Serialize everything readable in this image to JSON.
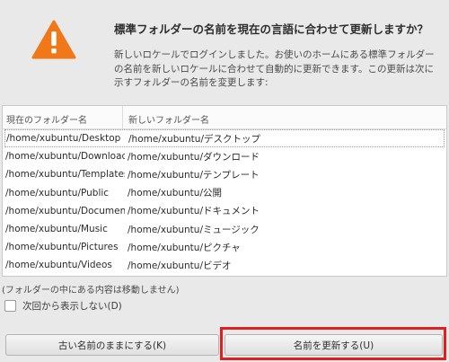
{
  "dialog": {
    "title": "標準フォルダーの名前を現在の言語に合わせて更新しますか？",
    "description": "新しいロケールでログインしました。お使いのホームにある標準フォルダーの名前を新しいロケールに合わせて自動的に更新できます。この更新は次に示すフォルダーの名前を変更します:",
    "icon": "warning-icon",
    "accent_color": "#f07818"
  },
  "table": {
    "headers": [
      "現在のフォルダー名",
      "新しいフォルダー名"
    ],
    "rows": [
      [
        "/home/xubuntu/Desktop",
        "/home/xubuntu/デスクトップ"
      ],
      [
        "/home/xubuntu/Downloads",
        "/home/xubuntu/ダウンロード"
      ],
      [
        "/home/xubuntu/Templates",
        "/home/xubuntu/テンプレート"
      ],
      [
        "/home/xubuntu/Public",
        "/home/xubuntu/公開"
      ],
      [
        "/home/xubuntu/Documents",
        "/home/xubuntu/ドキュメント"
      ],
      [
        "/home/xubuntu/Music",
        "/home/xubuntu/ミュージック"
      ],
      [
        "/home/xubuntu/Pictures",
        "/home/xubuntu/ピクチャ"
      ],
      [
        "/home/xubuntu/Videos",
        "/home/xubuntu/ビデオ"
      ]
    ]
  },
  "note": "(フォルダーの中にある内容は移動しません)",
  "checkbox": {
    "label": "次回から表示しない(D)",
    "checked": false
  },
  "buttons": {
    "keep_old": "古い名前のままにする(K)",
    "update": "名前を更新する(U)"
  },
  "highlight_color": "#e02020"
}
